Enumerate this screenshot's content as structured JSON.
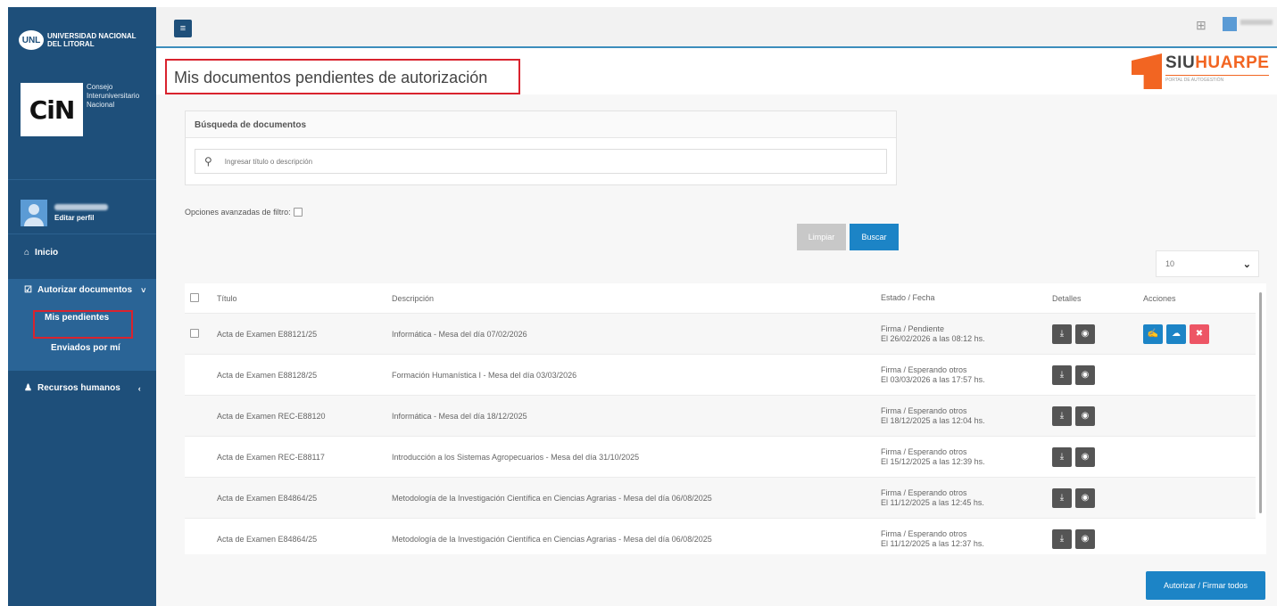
{
  "sidebar": {
    "unl_logo": "UNL",
    "unl_name": "UNIVERSIDAD NACIONAL DEL LITORAL",
    "cin_logo": "CiN",
    "cin_name": "Consejo Interuniversitario Nacional",
    "edit_profile": "Editar perfil",
    "nav_inicio": "Inicio",
    "nav_autorizar": "Autorizar documentos",
    "nav_mis_pendientes": "Mis pendientes",
    "nav_enviados": "Enviados por mí",
    "nav_recursos": "Recursos humanos"
  },
  "header": {
    "title": "Mis documentos pendientes de autorización",
    "brand": "SIUHUARPE",
    "brand_sub": "PORTAL DE AUTOGESTIÓN"
  },
  "search": {
    "panel_title": "Búsqueda de documentos",
    "placeholder": "Ingresar título o descripción",
    "adv_filter_label": "Opciones avanzadas de filtro:",
    "clear_label": "Limpiar",
    "search_label": "Buscar",
    "page_size": "10"
  },
  "table": {
    "headers": {
      "title": "Título",
      "description": "Descripción",
      "status": "Estado / Fecha",
      "details": "Detalles",
      "actions": "Acciones"
    },
    "rows": [
      {
        "title": "Acta de Examen E88121/25",
        "description": "Informática - Mesa del día 07/02/2026",
        "status": "Firma / Pendiente",
        "date": "El 26/02/2026 a las 08:12 hs."
      },
      {
        "title": "Acta de Examen E88128/25",
        "description": "Formación Humanística I - Mesa del día 03/03/2026",
        "status": "Firma / Esperando otros",
        "date": "El 03/03/2026 a las 17:57 hs."
      },
      {
        "title": "Acta de Examen REC-E88120",
        "description": "Informática - Mesa del día 18/12/2025",
        "status": "Firma / Esperando otros",
        "date": "El 18/12/2025 a las 12:04 hs."
      },
      {
        "title": "Acta de Examen REC-E88117",
        "description": "Introducción a los Sistemas Agropecuarios - Mesa del día 31/10/2025",
        "status": "Firma / Esperando otros",
        "date": "El 15/12/2025 a las 12:39 hs."
      },
      {
        "title": "Acta de Examen E84864/25",
        "description": "Metodología de la Investigación Científica en Ciencias Agrarias - Mesa del día 06/08/2025",
        "status": "Firma / Esperando otros",
        "date": "El 11/12/2025 a las 12:45 hs."
      },
      {
        "title": "Acta de Examen E84864/25",
        "description": "Metodología de la Investigación Científica en Ciencias Agrarias - Mesa del día 06/08/2025",
        "status": "Firma / Esperando otros",
        "date": "El 11/12/2025 a las 12:37 hs."
      }
    ]
  },
  "footer": {
    "authorize_all": "Autorizar / Firmar todos"
  },
  "colors": {
    "sidebar": "#1e4f7a",
    "primary": "#1c84c6",
    "danger": "#ed5565",
    "highlight": "#d9232e",
    "brand": "#f26522"
  },
  "icons": {
    "menu": "hamburger-icon",
    "apps": "grid-icon",
    "search": "search-icon",
    "home": "home-icon",
    "check": "checkbox-icon",
    "user": "user-icon",
    "download": "download-icon",
    "view": "eye-icon",
    "sign": "sign-icon",
    "upload": "upload-cloud-icon",
    "delete": "close-icon"
  }
}
